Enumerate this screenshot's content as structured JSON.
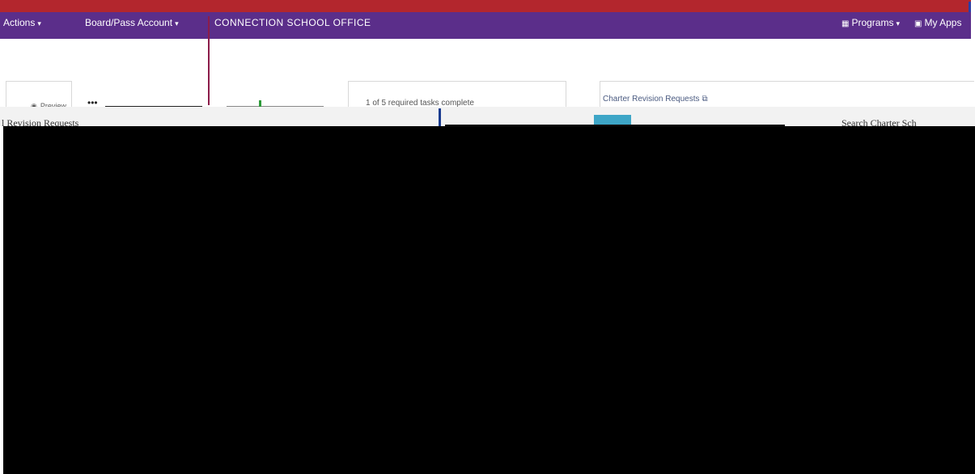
{
  "header": {
    "actions_label": "Actions",
    "account_label": "Board/Pass Account",
    "org_title": "CONNECTION SCHOOL OFFICE",
    "programs_label": "Programs",
    "my_apps_label": "My Apps"
  },
  "cards": {
    "preview_label": "Preview",
    "more_label": "•••",
    "tasks_text": "1 of 5 required tasks complete",
    "charter_link": "Charter Revision Requests"
  },
  "strip": {
    "left_text": "l Revision Requests",
    "right_text": "Search Charter Sch"
  },
  "colors": {
    "top_bar": "#b3262d",
    "nav_bar": "#5b2e8a",
    "accent_teal": "#3ea6c7",
    "accent_blue": "#1a3c8f"
  }
}
